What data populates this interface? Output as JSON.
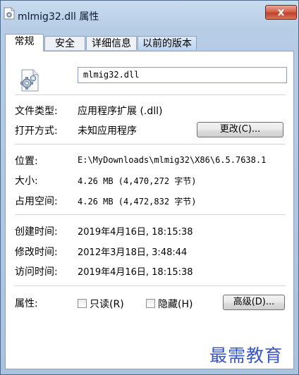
{
  "window": {
    "title": "mlmig32.dll 属性",
    "close_glyph": "x"
  },
  "tabs": [
    {
      "label": "常规",
      "active": true
    },
    {
      "label": "安全",
      "active": false
    },
    {
      "label": "详细信息",
      "active": false
    },
    {
      "label": "以前的版本",
      "active": false
    }
  ],
  "file": {
    "icon": "dll-gear-file-icon",
    "name": "mlmig32.dll"
  },
  "type_section": {
    "file_type_label": "文件类型:",
    "file_type_value": "应用程序扩展 (.dll)",
    "open_with_label": "打开方式:",
    "open_with_value": "未知应用程序",
    "change_button": "更改(C)..."
  },
  "location_section": {
    "location_label": "位置:",
    "location_value": "E:\\MyDownloads\\mlmig32\\X86\\6.5.7638.1",
    "size_label": "大小:",
    "size_value": "4.26 MB (4,470,272 字节)",
    "size_on_disk_label": "占用空间:",
    "size_on_disk_value": "4.26 MB (4,472,832 字节)"
  },
  "dates_section": {
    "created_label": "创建时间:",
    "created_value": "2019年4月16日, 18:15:38",
    "modified_label": "修改时间:",
    "modified_value": "2012年3月18日, 3:48:44",
    "accessed_label": "访问时间:",
    "accessed_value": "2019年4月16日, 18:15:38"
  },
  "attributes_section": {
    "label": "属性:",
    "readonly_label": "只读(R)",
    "readonly_checked": false,
    "hidden_label": "隐藏(H)",
    "hidden_checked": false,
    "advanced_button": "高级(D)..."
  },
  "watermark": "最需教育"
}
